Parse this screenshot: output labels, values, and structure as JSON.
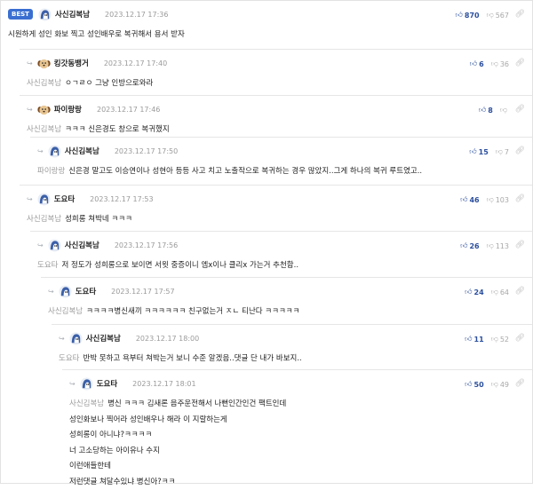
{
  "best_label": "BEST",
  "colors": {
    "accent": "#3a6fd1",
    "upvote": "#2b4f9e",
    "downvote": "#a8a8a8",
    "mention": "#9b9b9b"
  },
  "icons": {
    "up": "thumbs-up-icon",
    "down": "thumbs-down-icon",
    "link": "link-icon",
    "reply": "reply-arrow-icon"
  },
  "comments": [
    {
      "nick": "사신김복남",
      "date": "2023.12.17 17:36",
      "up": "870",
      "down": "567",
      "mention": "",
      "lines": [
        "시원하게 성인 화보 찍고 성인배우로 복귀해서 용서 받자"
      ]
    },
    {
      "nick": "킹갓동뱅거",
      "date": "2023.12.17 17:40",
      "up": "6",
      "down": "36",
      "mention": "사신김복남",
      "lines": [
        "ㅇㄱㄹㅇ 그냥 인방으로와라"
      ]
    },
    {
      "nick": "파이랑랑",
      "date": "2023.12.17 17:46",
      "up": "8",
      "down": "",
      "mention": "사신김복남",
      "lines": [
        "ㅋㅋㅋ 신은경도 창으로 복귀했지"
      ]
    },
    {
      "nick": "사신김복남",
      "date": "2023.12.17 17:50",
      "up": "15",
      "down": "7",
      "mention": "파이랑랑",
      "lines": [
        "신은경 말고도 이승연이나 성현아 등등 사고 치고 노출작으로 복귀하는 경우 많았지..그게 하나의 복귀 루트였고.."
      ]
    },
    {
      "nick": "도요타",
      "date": "2023.12.17 17:53",
      "up": "46",
      "down": "103",
      "mention": "사신김복남",
      "lines": [
        "성희롱 쳐박네 ㅋㅋㅋ"
      ]
    },
    {
      "nick": "사신김복남",
      "date": "2023.12.17 17:56",
      "up": "26",
      "down": "113",
      "mention": "도요타",
      "lines": [
        "저 정도가 성희롱으로 보이면 서윗 중증이니 엠x이나 클리x 가는거 추천함.."
      ]
    },
    {
      "nick": "도요타",
      "date": "2023.12.17 17:57",
      "up": "24",
      "down": "64",
      "mention": "사신김복남",
      "lines": [
        "ㅋㅋㅋㅋ병신새끼 ㅋㅋㅋㅋㅋㅋ 친구없는거 ㅈㄴ 티난다 ㅋㅋㅋㅋㅋ"
      ]
    },
    {
      "nick": "사신김복남",
      "date": "2023.12.17 18:00",
      "up": "11",
      "down": "52",
      "mention": "도요타",
      "lines": [
        "반박 못하고 욕부터 쳐박는거 보니 수준 알겠음..댓글 단 내가 바보지.."
      ]
    },
    {
      "nick": "도요타",
      "date": "2023.12.17 18:01",
      "up": "50",
      "down": "49",
      "mention": "사신김복남",
      "lines": [
        "병신 ㅋㅋㅋ 김새론 음주운전해서 나뻔인간인건 팩트인데",
        "성인화보나 찍어라 성인배우나 해라 이 지랄하는게",
        "성희롱이 아니냐?ㅋㅋㅋㅋ",
        "너 고소당하는 아이유나 수지",
        "이런애들한테",
        "저런댓글 쳐달수있냐 병신아?ㅋㅋ"
      ]
    }
  ]
}
